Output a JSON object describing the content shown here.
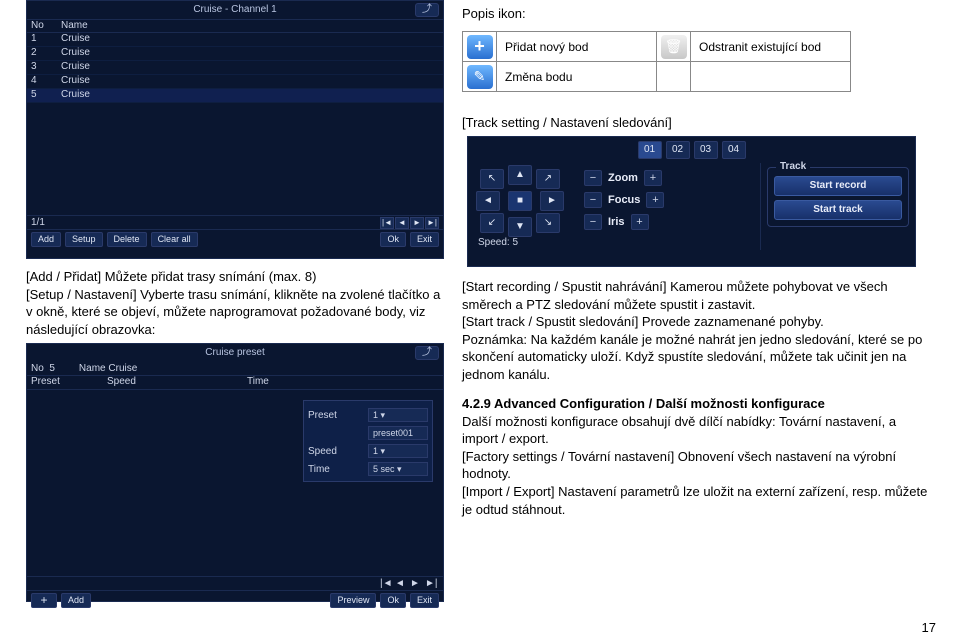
{
  "cruise": {
    "title": "Cruise - Channel 1",
    "head_no": "No",
    "head_name": "Name",
    "rows": [
      {
        "no": "1",
        "name": "Cruise"
      },
      {
        "no": "2",
        "name": "Cruise"
      },
      {
        "no": "3",
        "name": "Cruise"
      },
      {
        "no": "4",
        "name": "Cruise"
      },
      {
        "no": "5",
        "name": "Cruise"
      }
    ],
    "page": "1/1",
    "btn_add": "Add",
    "btn_setup": "Setup",
    "btn_delete": "Delete",
    "btn_clearall": "Clear all",
    "btn_ok": "Ok",
    "btn_exit": "Exit"
  },
  "legend": {
    "title": "Popis ikon:",
    "row1": "Přidat nový bod",
    "row1b": "Odstranit existující bod",
    "row2": "Změna bodu"
  },
  "track_heading": "[Track setting / Nastavení sledování]",
  "ptz": {
    "seg1": "01",
    "seg2": "02",
    "seg3": "03",
    "seg4": "04",
    "zoom": "Zoom",
    "focus": "Focus",
    "iris": "Iris",
    "speed": "Speed: 5",
    "group_title": "Track",
    "btn_record": "Start record",
    "btn_track": "Start track"
  },
  "left_text": {
    "l1": "[Add / Přidat] Můžete přidat trasy snímání (max. 8)",
    "l2": "[Setup / Nastavení] Vyberte trasu snímání, klikněte na zvolené tlačítko a v okně, které se objeví, můžete naprogramovat požadované body, viz následující obrazovka:"
  },
  "preset": {
    "title": "Cruise preset",
    "no_label": "No",
    "no_val": "5",
    "name_label": "Name",
    "name_val": "Cruise",
    "h_preset": "Preset",
    "h_speed": "Speed",
    "h_time": "Time",
    "pop_preset": "Preset",
    "pop_preset_val": "1",
    "pop_name": "preset001",
    "pop_speed": "Speed",
    "pop_speed_val": "1",
    "pop_time": "Time",
    "pop_time_val": "5 sec",
    "btn_add": "Add",
    "btn_preview": "Preview",
    "btn_ok": "Ok",
    "btn_exit": "Exit"
  },
  "right": {
    "p1": "[Start recording / Spustit nahrávání] Kamerou můžete pohybovat ve všech směrech a PTZ sledování můžete spustit i zastavit.",
    "p2": "[Start track / Spustit sledování] Provede zaznamenané pohyby.",
    "p3": "Poznámka: Na každém kanále je možné nahrát jen jedno sledování, které se po skončení automaticky uloží. Když spustíte sledování, můžete tak učinit jen na jednom kanálu.",
    "h": "4.2.9 Advanced Configuration / Další možnosti konfigurace",
    "p4": "Další možnosti konfigurace obsahují dvě dílčí nabídky: Tovární nastavení, a import / export.",
    "p5": "[Factory settings / Tovární nastavení] Obnovení všech nastavení na výrobní hodnoty.",
    "p6": "[Import / Export] Nastavení parametrů lze uložit na externí zařízení, resp. můžete je odtud stáhnout."
  },
  "page": "17",
  "arrows": {
    "first": "|◄",
    "prev": "◄",
    "next": "►",
    "last": "►|"
  }
}
